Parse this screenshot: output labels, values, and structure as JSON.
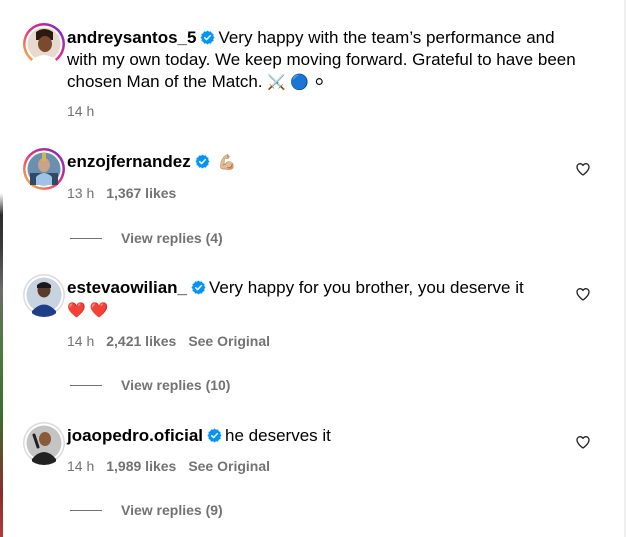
{
  "post": {
    "username": "andreysantos_5",
    "caption": "Very happy with the team’s performance and with my own today. We keep moving forward. Grateful to have been chosen Man of the Match.",
    "caption_emojis": "⚔️ 🔵 ⚪",
    "time": "14 h"
  },
  "comments": [
    {
      "username": "enzojfernandez",
      "text": "💪🏼",
      "time": "13 h",
      "likes": "1,367 likes",
      "see_original": "",
      "view_replies": "View replies (4)"
    },
    {
      "username": "estevaowilian_",
      "text": "Very happy for you brother, you deserve it",
      "text_emojis": "❤️ ❤️",
      "time": "14 h",
      "likes": "2,421 likes",
      "see_original": "See Original",
      "view_replies": "View replies (10)"
    },
    {
      "username": "joaopedro.oficial",
      "text": "he deserves it",
      "time": "14 h",
      "likes": "1,989 likes",
      "see_original": "See Original",
      "view_replies": "View replies (9)"
    }
  ],
  "colors": {
    "verified": "#0095f6",
    "meta_text": "#737373",
    "story_ring_start": "#f9ce34",
    "story_ring_mid": "#ee2a7b",
    "story_ring_end": "#6228d7"
  },
  "icons": {
    "verified": "verified-badge-icon",
    "like": "heart-outline-icon"
  }
}
